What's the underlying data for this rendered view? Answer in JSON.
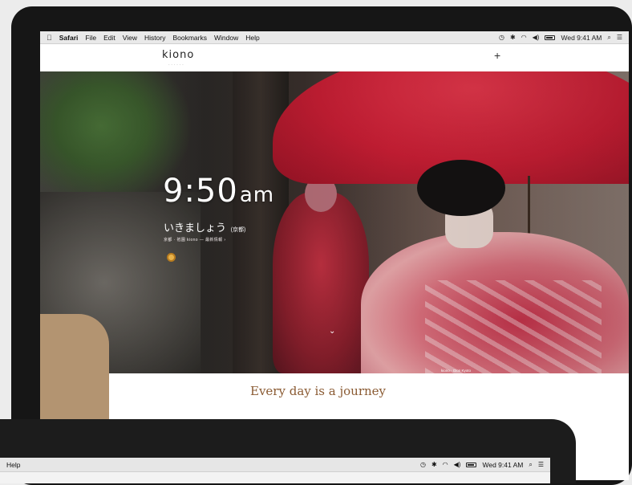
{
  "menubar": {
    "app_name": "Safari",
    "items": [
      "File",
      "Edit",
      "View",
      "History",
      "Bookmarks",
      "Window",
      "Help"
    ],
    "clock": "Wed 9:41 AM"
  },
  "site": {
    "logo": "kiono",
    "plus_label": "+"
  },
  "hero": {
    "time": "9:50",
    "ampm": "am",
    "greeting": "いきましょう",
    "greeting_sub": "(京都)",
    "location": "京都 · 祇園 kiono — 最新情報 ›",
    "scroll_glyph": "⌄",
    "credit": "kiono · Gion Kyoto"
  },
  "main": {
    "headline": "Every day is a journey"
  },
  "laptop": {
    "menu_item": "Help",
    "clock": "Wed 9:41 AM"
  }
}
